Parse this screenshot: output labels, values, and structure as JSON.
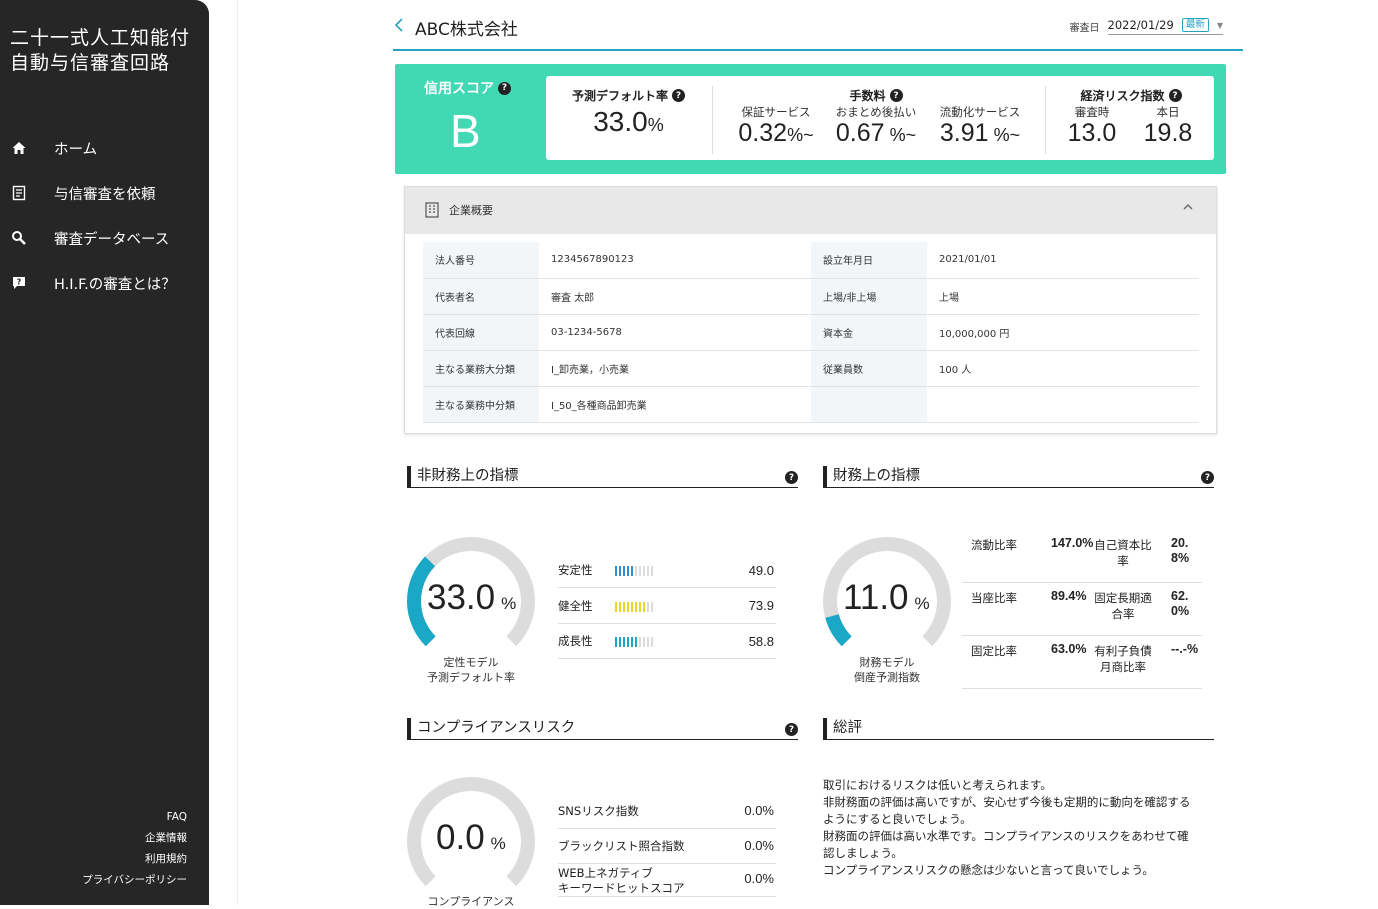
{
  "sidebar": {
    "logo_line1": "二十一式人工知能付",
    "logo_line2": "自動与信審査回路",
    "items": [
      {
        "label": "ホーム",
        "icon": "home-icon"
      },
      {
        "label": "与信審査を依頼",
        "icon": "document-icon"
      },
      {
        "label": "審査データベース",
        "icon": "search-icon"
      },
      {
        "label": "H.I.F.の審査とは？",
        "icon": "help-chat-icon"
      }
    ],
    "footer": [
      "FAQ",
      "企業情報",
      "利用規約",
      "プライバシーポリシー"
    ]
  },
  "header": {
    "company": "ABC株式会社",
    "date_label": "審査日",
    "date_value": "2022/01/29",
    "latest_badge": "最新"
  },
  "score": {
    "title": "信用スコア",
    "grade": "B",
    "pd_title": "予測デフォルト率",
    "pd_value": "33.0",
    "pd_unit": "%",
    "fee_title": "手数料",
    "fees": [
      {
        "label": "保証サービス",
        "value": "0.32",
        "unit": "%~"
      },
      {
        "label": "おまとめ後払い",
        "value": "0.67",
        "unit": "%~"
      },
      {
        "label": "流動化サービス",
        "value": "3.91",
        "unit": "%~"
      }
    ],
    "risk_title": "経済リスク指数",
    "risk": [
      {
        "label": "審査時",
        "value": "13.0"
      },
      {
        "label": "本日",
        "value": "19.8"
      }
    ]
  },
  "overview": {
    "title": "企業概要",
    "rows": [
      {
        "k1": "法人番号",
        "v1": "1234567890123",
        "k2": "設立年月日",
        "v2": "2021/01/01"
      },
      {
        "k1": "代表者名",
        "v1": "審査 太郎",
        "k2": "上場/非上場",
        "v2": "上場"
      },
      {
        "k1": "代表回線",
        "v1": "03-1234-5678",
        "k2": "資本金",
        "v2": "10,000,000 円"
      },
      {
        "k1": "主なる業務大分類",
        "v1": "I_卸売業，小売業",
        "k2": "従業員数",
        "v2": "100 人"
      },
      {
        "k1": "主なる業務中分類",
        "v1": "I_50_各種商品卸売業",
        "k2": "",
        "v2": ""
      }
    ]
  },
  "nonfinancial": {
    "title": "非財務上の指標",
    "gauge_value": "33.0",
    "gauge_fraction": 0.33,
    "gauge_unit": "%",
    "caption1": "定性モデル",
    "caption2": "予測デフォルト率",
    "accent": "#1aa8c6",
    "metrics": [
      {
        "label": "安定性",
        "value": "49.0",
        "level": 5,
        "color": "#2f8fd0"
      },
      {
        "label": "健全性",
        "value": "73.9",
        "level": 8,
        "color": "#e8d52a"
      },
      {
        "label": "成長性",
        "value": "58.8",
        "level": 6,
        "color": "#1aa8c6"
      }
    ]
  },
  "financial": {
    "title": "財務上の指標",
    "gauge_value": "11.0",
    "gauge_fraction": 0.11,
    "gauge_unit": "%",
    "caption1": "財務モデル",
    "caption2": "倒産予測指数",
    "rows": [
      {
        "a": "流動比率",
        "b": "147.0%",
        "c": "自己資本比率",
        "d": "20.8%"
      },
      {
        "a": "当座比率",
        "b": "89.4%",
        "c": "固定長期適合率",
        "d": "62.0%"
      },
      {
        "a": "固定比率",
        "b": "63.0%",
        "c": "有利子負債月商比率",
        "d": "--.-%"
      }
    ]
  },
  "compliance": {
    "title": "コンプライアンスリスク",
    "gauge_value": "0.0",
    "gauge_fraction": 0.0,
    "gauge_unit": "%",
    "caption1": "コンプライアンス",
    "metrics": [
      {
        "label": "SNSリスク指数",
        "value": "0.0%"
      },
      {
        "label": "ブラックリスト照合指数",
        "value": "0.0%"
      },
      {
        "label": "WEB上ネガティブ\nキーワードヒットスコア",
        "value": "0.0%"
      }
    ]
  },
  "summary": {
    "title": "総評",
    "lines": [
      "取引におけるリスクは低いと考えられます。",
      "非財務面の評価は高いですが、安心せず今後も定期的に動向を確認する",
      "ようにすると良いでしょう。",
      "財務面の評価は高い水準です。コンプライアンスのリスクをあわせて確",
      "認しましょう。",
      "コンプライアンスリスクの懸念は少ないと言って良いでしょう。"
    ]
  },
  "colors": {
    "sidebar": "#262626",
    "band": "#40d9b4",
    "accent": "#2aa3c2",
    "gauge_track": "#dcdcdc",
    "gauge_fill": "#1aa8c6"
  }
}
